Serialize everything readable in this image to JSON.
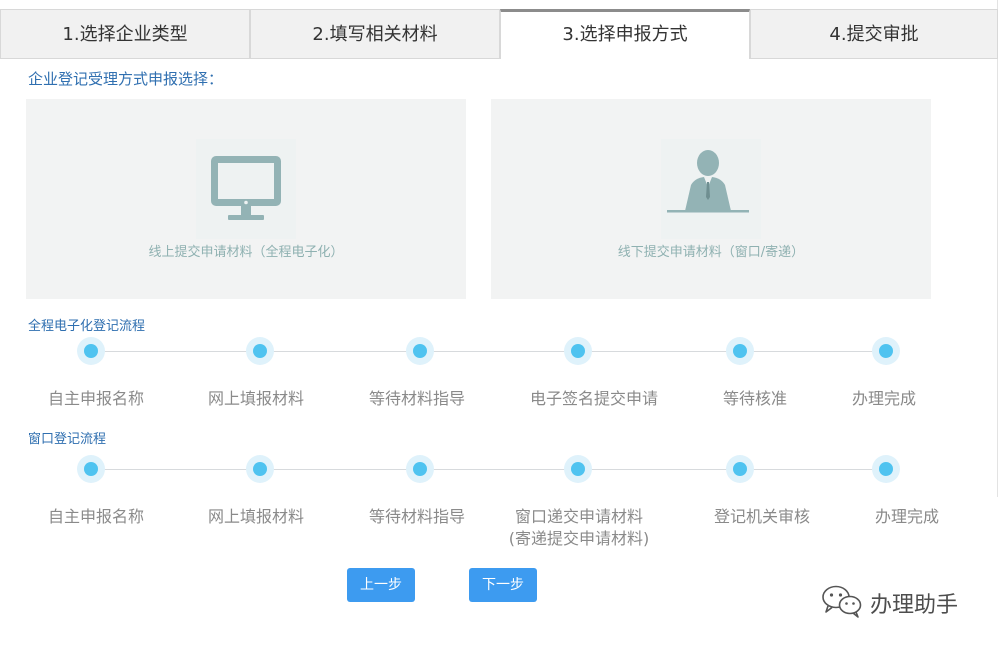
{
  "tabs": [
    {
      "label": "1.选择企业类型"
    },
    {
      "label": "2.填写相关材料"
    },
    {
      "label": "3.选择申报方式"
    },
    {
      "label": "4.提交审批"
    }
  ],
  "active_tab": 2,
  "section_title": "企业登记受理方式申报选择：",
  "options": {
    "online": {
      "label": "线上提交申请材料（全程电子化）",
      "icon": "monitor-icon"
    },
    "offline": {
      "label": "线下提交申请材料（窗口/寄递）",
      "icon": "clerk-at-desk-icon"
    }
  },
  "flows": {
    "electronic": {
      "title": "全程电子化登记流程",
      "steps": [
        "自主申报名称",
        "网上填报材料",
        "等待材料指导",
        "电子签名提交申请",
        "等待核准",
        "办理完成"
      ]
    },
    "window": {
      "title": "窗口登记流程",
      "steps": [
        "自主申报名称",
        "网上填报材料",
        "等待材料指导",
        "窗口递交申请材料",
        "登记机关审核",
        "办理完成"
      ],
      "step4_note": "(寄递提交申请材料)"
    }
  },
  "buttons": {
    "prev": "上一步",
    "next": "下一步"
  },
  "watermark": {
    "text": "办理助手",
    "icon": "wechat-icon"
  },
  "colors": {
    "accent": "#3d9bf0",
    "link": "#2f6fb0",
    "dot": "#4fc3f0",
    "icon": "#93b3b5"
  }
}
